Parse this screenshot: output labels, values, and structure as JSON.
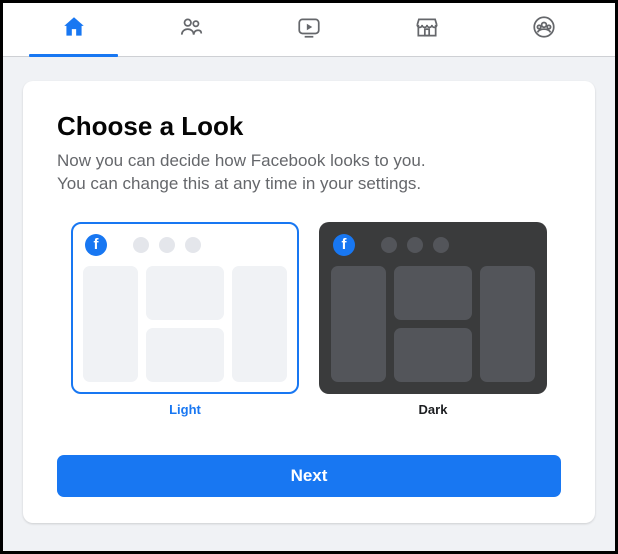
{
  "nav": {
    "items": [
      {
        "name": "home",
        "active": true
      },
      {
        "name": "friends",
        "active": false
      },
      {
        "name": "watch",
        "active": false
      },
      {
        "name": "marketplace",
        "active": false
      },
      {
        "name": "groups",
        "active": false
      }
    ]
  },
  "dialog": {
    "title": "Choose a Look",
    "description_line1": "Now you can decide how Facebook looks to you.",
    "description_line2": "You can change this at any time in your settings.",
    "options": {
      "light": {
        "label": "Light",
        "selected": true
      },
      "dark": {
        "label": "Dark",
        "selected": false
      }
    },
    "next_label": "Next"
  },
  "colors": {
    "accent": "#1877f2",
    "muted_text": "#65676b",
    "dark_panel": "#3a3b3c"
  }
}
